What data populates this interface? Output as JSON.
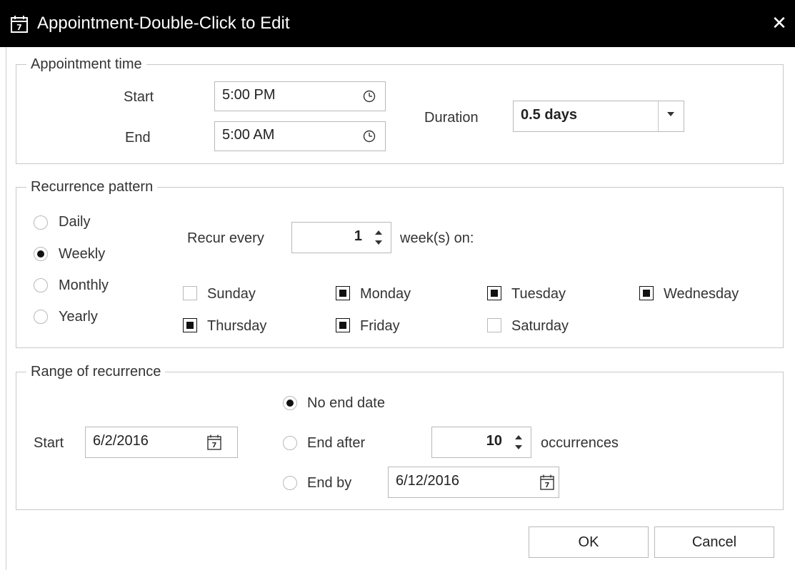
{
  "window": {
    "title": "Appointment-Double-Click to Edit",
    "close_glyph": "✕",
    "icon": "calendar-icon"
  },
  "appointment_time": {
    "legend": "Appointment time",
    "start_label": "Start",
    "start_value": "5:00 PM",
    "end_label": "End",
    "end_value": "5:00 AM",
    "duration_label": "Duration",
    "duration_value": "0.5 days"
  },
  "recurrence": {
    "legend": "Recurrence pattern",
    "options": [
      {
        "label": "Daily",
        "selected": false
      },
      {
        "label": "Weekly",
        "selected": true
      },
      {
        "label": "Monthly",
        "selected": false
      },
      {
        "label": "Yearly",
        "selected": false
      }
    ],
    "recur_every_label": "Recur every",
    "recur_every_value": "1",
    "weeks_on_label": "week(s) on:",
    "days": [
      {
        "label": "Sunday",
        "checked": false
      },
      {
        "label": "Monday",
        "checked": true
      },
      {
        "label": "Tuesday",
        "checked": true
      },
      {
        "label": "Wednesday",
        "checked": true
      },
      {
        "label": "Thursday",
        "checked": true
      },
      {
        "label": "Friday",
        "checked": true
      },
      {
        "label": "Saturday",
        "checked": false
      }
    ]
  },
  "range": {
    "legend": "Range of recurrence",
    "start_label": "Start",
    "start_value": "6/2/2016",
    "no_end_label": "No end date",
    "end_after_label": "End after",
    "end_after_value": "10",
    "occurrences_label": "occurrences",
    "end_by_label": "End by",
    "end_by_value": "6/12/2016",
    "selected": "no_end"
  },
  "buttons": {
    "ok": "OK",
    "cancel": "Cancel"
  }
}
